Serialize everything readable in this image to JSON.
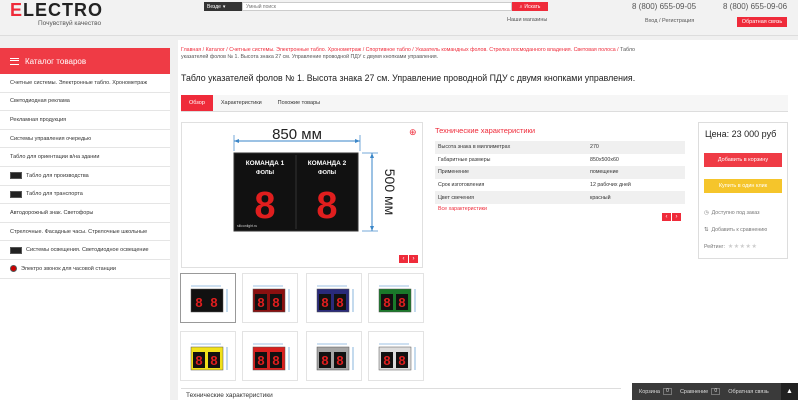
{
  "header": {
    "logo_text": "LECTRO",
    "logo_prefix": "E",
    "slogan": "Почувствуй качество",
    "search_scope": "Везде",
    "search_placeholder": "Умный поиск",
    "search_button": "Искать",
    "shops_link": "Наши магазины",
    "phone1": "8 (800) 655-09-05",
    "phone2": "8 (800) 655-09-06",
    "login_link": "Вход / Регистрация",
    "callback_button": "Обратная связь"
  },
  "sidebar": {
    "header": "Каталог товаров",
    "items": [
      "Счетные системы. Электронные табло. Хронометраж",
      "Светодиодная реклама",
      "Рекламная продукция",
      "Системы управления очередью",
      "Табло для ориентации в/на здании",
      "Табло для производства",
      "Табло для транспорта",
      "Автодорожный знак. Светофоры",
      "Стрелочные. Фасадные часы. Стрелочные школьные",
      "Системы освещения. Светодиодное освещение",
      "Электро звонок для часовой станции"
    ]
  },
  "breadcrumb": {
    "text": "Главная / Каталог / Счетные системы. Электронные табло. Хронометраж / Спортивное табло / Указатель командных фолов. Стрелка посмоданного владения. Световая полоса /",
    "last": "Табло указателей фолов № 1. Высота знака 27 см. Управление проводной ПДУ с двумя кнопками управления."
  },
  "product": {
    "title": "Табло указателей фолов № 1. Высота знака 27 см. Управление проводной ПДУ с двумя кнопками управления.",
    "tabs": [
      "Обзор",
      "Характеристики",
      "Похожие товары"
    ],
    "image": {
      "width_label": "850 мм",
      "height_label": "500 мм",
      "team1": "КОМАНДА 1",
      "team2": "КОМАНДА 2",
      "fouls": "ФОЛЫ",
      "digit": "8",
      "brand": "siliconlight.ru"
    },
    "thumb_colors": [
      "#111111",
      "#8a1010",
      "#2a2a7a",
      "#1a7a2a",
      "#f1e11a",
      "#d8201f",
      "#a5a5a5",
      "#dcdcdc"
    ]
  },
  "specs": {
    "title": "Технические характеристики",
    "rows": [
      {
        "k": "Высота знака в миллиметрах",
        "v": "270"
      },
      {
        "k": "Габаритные размеры",
        "v": "850x500x60"
      },
      {
        "k": "Применение",
        "v": "помещение"
      },
      {
        "k": "Срок изготовления",
        "v": "12 рабочих дней"
      },
      {
        "k": "Цвет свечения",
        "v": "красный"
      }
    ],
    "all_link": "Все характеристики"
  },
  "buybox": {
    "price": "Цена: 23 000 руб",
    "cart_button": "Добавить в корзину",
    "one_click_button": "Купить в один клик",
    "availability": "Доступно под заказ",
    "compare": "Добавить к сравнению",
    "rating_label": "Рейтинг:",
    "stars": "★★★★★"
  },
  "bottom": {
    "section_title": "Технические характеристики"
  },
  "floatbar": {
    "cart_label": "Корзина",
    "cart_count": "0",
    "compare_label": "Сравнение",
    "compare_count": "0",
    "feedback_label": "Обратная связь",
    "up_icon": "▲"
  },
  "colors": {
    "accent": "#ef2b3a",
    "yellow": "#f5c52b"
  }
}
